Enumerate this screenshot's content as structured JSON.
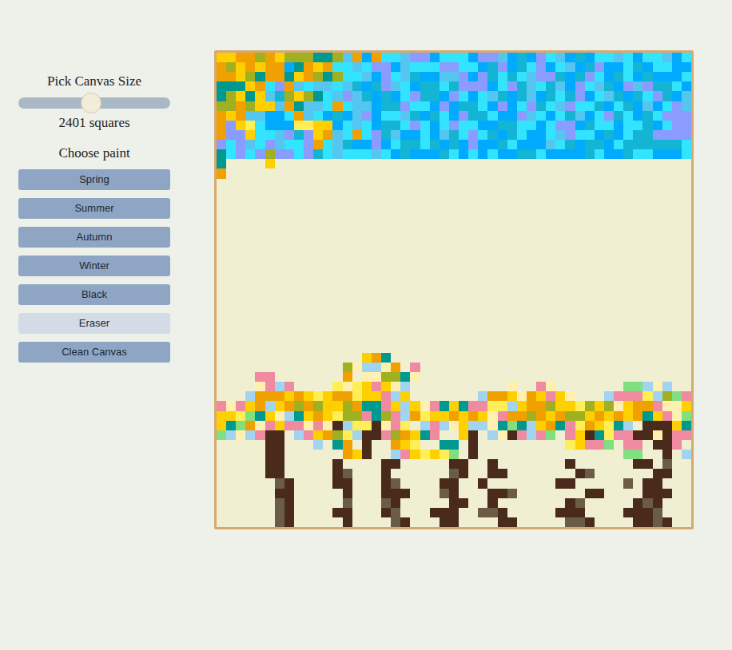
{
  "sidebar": {
    "size_label": "Pick Canvas Size",
    "size_slider": {
      "level": 0.48
    },
    "size_reading": "2401 squares",
    "paint_label": "Choose paint",
    "buttons": [
      {
        "label": "Spring",
        "selected": false
      },
      {
        "label": "Summer",
        "selected": false
      },
      {
        "label": "Autumn",
        "selected": false
      },
      {
        "label": "Winter",
        "selected": false
      },
      {
        "label": "Black",
        "selected": false
      },
      {
        "label": "Eraser",
        "selected": true
      },
      {
        "label": "Clean Canvas",
        "selected": false
      }
    ]
  },
  "canvas": {
    "palette": {
      ".": "#f1efd1",
      "A": "#00aaff",
      "B": "#33e4ff",
      "C": "#55c6f0",
      "D": "#8a9cff",
      "E": "#14b4d4",
      "o": "#f0a000",
      "y": "#ffd000",
      "g": "#a0b020",
      "t": "#009990",
      "p": "#f08aa0",
      "l": "#a0d4f0",
      "m": "#80e080",
      "w": "#fff0b0",
      "e": "#ffee55",
      "k": "#4a2a1a",
      "n": "#6b5d45"
    },
    "rows": [
      "yyoogoygggttgCoAoBBCDDABBBADDCAEADBCAEABBCBABBCAB",
      "ogyoyooAtoyoBBCBDDACBBBDDBBAEDAEBDABCAEDAABEABBAA",
      "ooygtootyogtgBBCADBCEAACCDADEBEBCDDEAEDBAEBAEAAAB",
      "tttyoBDoCBCCBCEAEDCBAEEBEDDDABDECBECADBCEADCDEEBA",
      "tgytyCEgygtBCDCEAEABDEEADBABCEAECAEBEDABCEAEBDEAC",
      "ggogyyCotCCBoBCCAEEDBBADAEEBADABDEBCDBBEABEACABDC",
      "oyoCCAABoCBAEACDABBCEAEBADEEBAADCBABECABDEBAEBDDD",
      "oDyeBAAAeeyyABCBAEEBDBABDBBAAEEBBABDDAEBBABBEABDD",
      "oDDyBBCDEDyoCBoBDECAABACEBDBEAEBAABCDBBAEABEEDDDD",
      "DBDCBDCBBDoBCEAADABEEBEAEADAAEBAAACBEAEEABEEEEEEB",
      "tBDBDgDDBDEBCBBBCBAEAAAEBABABAAEEBAAAAEBAAEBBAAAB",
      "t....y.",
      "o",
      "",
      "",
      "",
      "",
      "",
      "",
      "",
      "",
      "",
      "",
      "",
      "",
      "",
      "",
      "",
      "",
      "",
      "",
      "...............yot",
      ".............gwllwo.p",
      "....pp.......o.wwggtw",
      "....wplp....eweypywl..........w..pw.......mmlwl.",
      "...loooyoyeyooeyyply.......looywoypyw...lpppelgmp",
      "pwpyolyogogyygottpylywptytppeelyoogyyegygwyoopwwy",
      "yyemtywltyoyeggptgploeyyoyoywpoogoyoggyoyoyotypwm",
      "ytmowpyppwpwkleekwpe.lplwyllwtmtlyotpeoyetl.kkkyt",
      "mlwlpkk.lpyogelkkpgoytp..yk.lwkplpm.pykteppkkwkpp",
      ".....kk...l.to.k..oye..tt.k.........eyppm.pp.kkp",
      ".....kk......oyk..lpyeyem.k...............mm..k.l",
      ".....kk.....k....kk.....kk..k.......k......kk.n..",
      ".....kk.....kn...k......nk..kk.......kn......kk...",
      "......nk....kk...kn....kk..k.......kk.....n.kk..",
      "......kk.....k...kkk...nk...kkn.......kk....kkk...",
      "......nk.....n...nk.....kk..k.......kn.....knk...",
      "......nk....kk...kn...kkk..nnk.....kkk....kkkn..",
      "......nk.....k....nk...kk....kk.....nnk....kknk.."
    ]
  }
}
